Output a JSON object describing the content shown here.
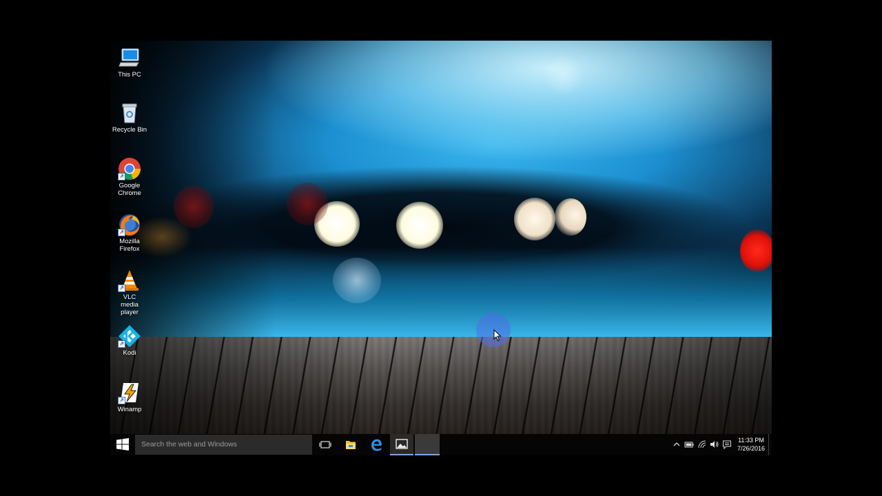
{
  "desktop": {
    "icons": [
      {
        "label": "This PC",
        "icon": "computer-icon"
      },
      {
        "label": "Recycle Bin",
        "icon": "recycle-bin-icon"
      },
      {
        "label": "Google Chrome",
        "icon": "chrome-icon"
      },
      {
        "label": "Mozilla Firefox",
        "icon": "firefox-icon"
      },
      {
        "label": "VLC media player",
        "icon": "vlc-icon"
      },
      {
        "label": "Kodi",
        "icon": "kodi-icon"
      },
      {
        "label": "Winamp",
        "icon": "winamp-icon"
      }
    ]
  },
  "taskbar": {
    "start_icon": "windows-logo-icon",
    "search_placeholder": "Search the web and Windows",
    "pinned": [
      {
        "name": "task-view",
        "icon": "task-view-icon"
      },
      {
        "name": "file-explorer",
        "icon": "folder-icon"
      },
      {
        "name": "edge",
        "icon": "edge-icon"
      },
      {
        "name": "photos",
        "icon": "photos-icon"
      },
      {
        "name": "blank-app",
        "icon": "blank-window-icon"
      }
    ],
    "tray": {
      "icons": [
        "chevron-up-icon",
        "battery-icon",
        "wifi-icon",
        "volume-icon",
        "action-center-icon"
      ],
      "time": "11:33 PM",
      "date": "7/26/2016"
    }
  },
  "colors": {
    "taskbar": "#050505",
    "search_box": "#2b2b2b",
    "accent": "#7aa7e6"
  }
}
